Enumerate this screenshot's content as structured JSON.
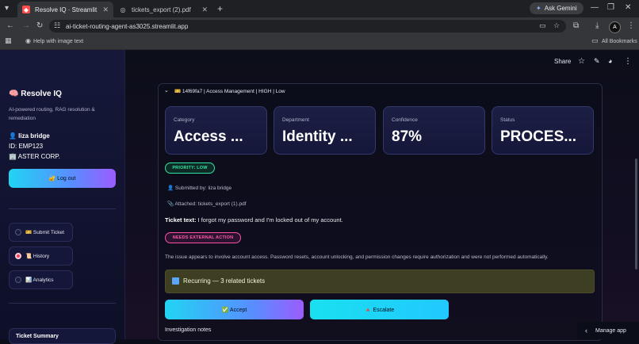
{
  "browser": {
    "tabs": [
      {
        "title": "Resolve IQ · Streamlit",
        "active": true
      },
      {
        "title": "tickets_export (2).pdf",
        "active": false
      }
    ],
    "url": "ai-ticket-routing-agent-as3025.streamlit.app",
    "ask_gemini": "Ask Gemini",
    "profile_initial": "A",
    "bookmark_help": "Help with image text",
    "all_bookmarks": "All Bookmarks"
  },
  "sidebar": {
    "brand": "🧠 Resolve IQ",
    "tagline": "AI-powered routing, RAG resolution & remediation",
    "user_name": "👤 liza bridge",
    "user_id": "ID: EMP123",
    "user_org": "🏢 ASTER CORP.",
    "logout_label": "🔐 Log out",
    "nav": [
      {
        "label": "🎫 Submit Ticket",
        "selected": false
      },
      {
        "label": "📜 History",
        "selected": true
      },
      {
        "label": "📊 Analytics",
        "selected": false
      }
    ],
    "bottom_card_label": "Ticket Summary"
  },
  "header": {
    "share_label": "Share"
  },
  "ticket": {
    "expander_title": "🎫 14f69fa7 | Access Management | HIGH | Low",
    "cards": [
      {
        "label": "Category",
        "value": "Access ..."
      },
      {
        "label": "Department",
        "value": "Identity ..."
      },
      {
        "label": "Confidence",
        "value": "87%"
      },
      {
        "label": "Status",
        "value": "PROCES..."
      }
    ],
    "priority_badge": "PRIORITY: LOW",
    "submitted_by": "👤 Submitted by: liza bridge",
    "attached": "📎 Attached: tickets_export (1).pdf",
    "ticket_text_label": "Ticket text:",
    "ticket_text": " I forgot my password and I'm locked out of my account.",
    "external_badge": "NEEDS EXTERNAL ACTION",
    "description": "The issue appears to involve account access. Password resets, account unlocking, and permission changes require authorization and were not performed automatically.",
    "recurring": "Recurring — 3 related tickets",
    "accept_label": "✅ Accept",
    "escalate_label": "🔺 Escalate",
    "notes_label": "Investigation notes"
  },
  "footer": {
    "manage_app": "Manage app"
  },
  "colors": {
    "accent_cyan": "#21d4f3",
    "accent_purple": "#9b5cff",
    "priority_green": "#2ee6a0",
    "external_pink": "#ff4fa3",
    "recurring_bg": "#3e3f22"
  }
}
